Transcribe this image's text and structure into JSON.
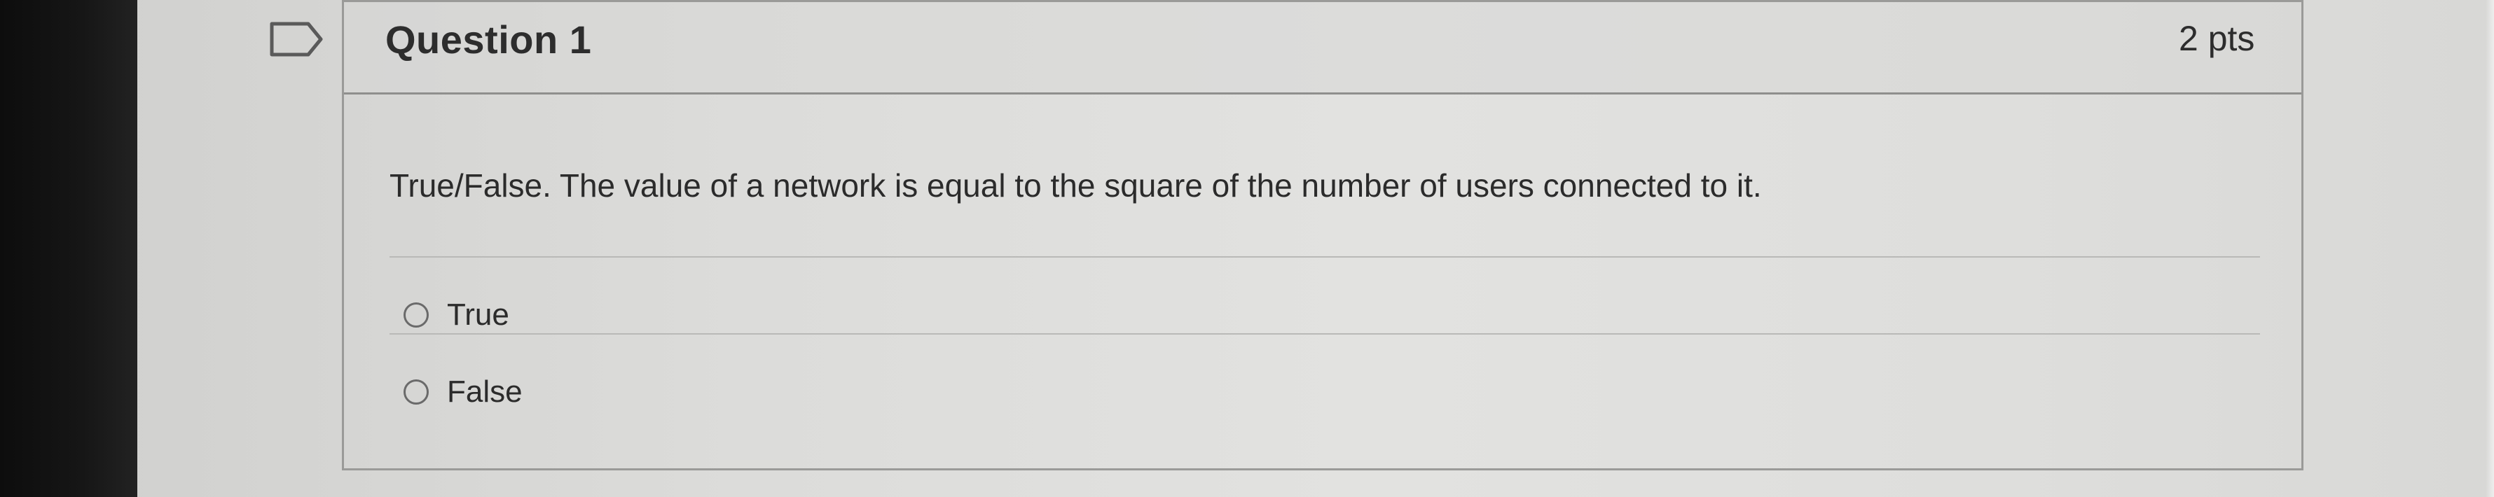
{
  "question": {
    "title": "Question 1",
    "points": "2 pts",
    "text": "True/False. The value of a network is equal to the square of the number of users connected to it.",
    "answers": [
      {
        "label": "True"
      },
      {
        "label": "False"
      }
    ]
  },
  "icons": {
    "flag": "bookmark-flag-icon",
    "radio": "radio-button-icon"
  },
  "colors": {
    "text": "#2b2b2b",
    "border": "#9a9a98"
  }
}
